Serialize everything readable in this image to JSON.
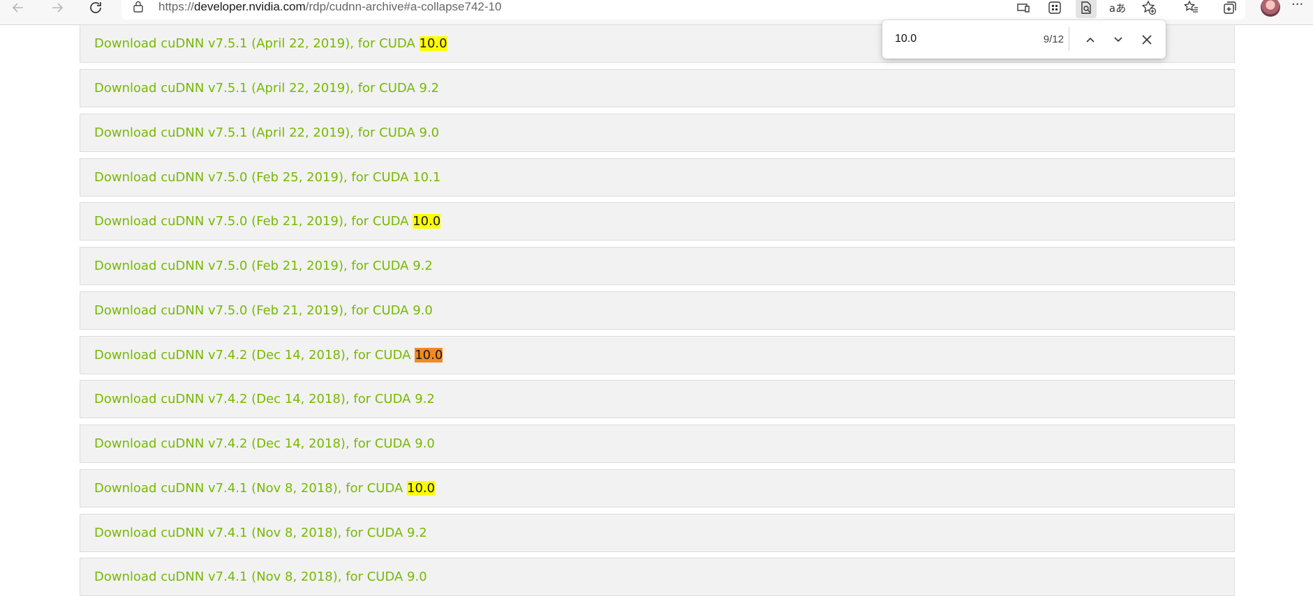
{
  "browser": {
    "url_prefix": "https://",
    "url_host": "developer.nvidia.com",
    "url_path": "/rdp/cudnn-archive#a-collapse742-10",
    "toolbar_icons": [
      "back-icon",
      "forward-icon",
      "refresh-icon",
      "lock-icon",
      "device-icon",
      "apps-icon",
      "find-icon",
      "translate-icon",
      "add-favorite-icon",
      "favorites-icon",
      "collections-icon",
      "profile-avatar",
      "more-icon"
    ]
  },
  "find": {
    "query": "10.0",
    "count": "9/12"
  },
  "downloads": [
    {
      "prefix": "Download cuDNN v7.5.1 (April 22, 2019), for CUDA ",
      "version": "10.0",
      "match": "highlight"
    },
    {
      "prefix": "Download cuDNN v7.5.1 (April 22, 2019), for CUDA ",
      "version": "9.2",
      "match": "none"
    },
    {
      "prefix": "Download cuDNN v7.5.1 (April 22, 2019), for CUDA ",
      "version": "9.0",
      "match": "none"
    },
    {
      "prefix": "Download cuDNN v7.5.0 (Feb 25, 2019), for CUDA ",
      "version": "10.1",
      "match": "none"
    },
    {
      "prefix": "Download cuDNN v7.5.0 (Feb 21, 2019), for CUDA ",
      "version": "10.0",
      "match": "highlight"
    },
    {
      "prefix": "Download cuDNN v7.5.0 (Feb 21, 2019), for CUDA ",
      "version": "9.2",
      "match": "none"
    },
    {
      "prefix": "Download cuDNN v7.5.0 (Feb 21, 2019), for CUDA ",
      "version": "9.0",
      "match": "none"
    },
    {
      "prefix": "Download cuDNN v7.4.2 (Dec 14, 2018), for CUDA ",
      "version": "10.0",
      "match": "current"
    },
    {
      "prefix": "Download cuDNN v7.4.2 (Dec 14, 2018), for CUDA ",
      "version": "9.2",
      "match": "none"
    },
    {
      "prefix": "Download cuDNN v7.4.2 (Dec 14, 2018), for CUDA ",
      "version": "9.0",
      "match": "none"
    },
    {
      "prefix": "Download cuDNN v7.4.1 (Nov 8, 2018), for CUDA ",
      "version": "10.0",
      "match": "highlight"
    },
    {
      "prefix": "Download cuDNN v7.4.1 (Nov 8, 2018), for CUDA ",
      "version": "9.2",
      "match": "none"
    },
    {
      "prefix": "Download cuDNN v7.4.1 (Nov 8, 2018), for CUDA ",
      "version": "9.0",
      "match": "none"
    }
  ],
  "colors": {
    "link": "#76b900",
    "highlight": "#ffff00",
    "current_match": "#f08a24"
  }
}
